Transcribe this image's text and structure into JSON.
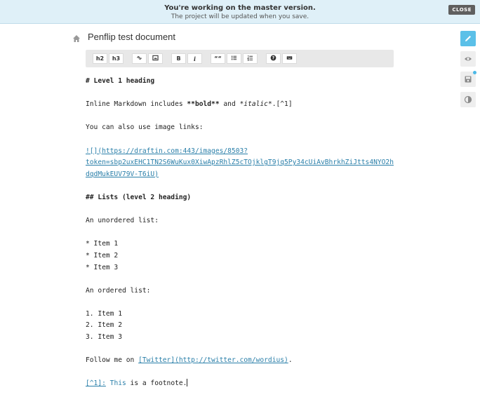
{
  "banner": {
    "title": "You're working on the master version.",
    "subtitle": "The project will be updated when you save.",
    "close_label": "CLOSE"
  },
  "document": {
    "title": "Penflip test document"
  },
  "toolbar": {
    "h2": "h2",
    "h3": "h3",
    "bold": "B",
    "italic": "i",
    "quote": "““",
    "help": "?"
  },
  "editor": {
    "l1": "# Level 1 heading",
    "l2_prefix": "Inline Markdown includes ",
    "l2_bold": "**bold**",
    "l2_mid": " and ",
    "l2_italic": "*italic*",
    "l2_suffix": ".[^1]",
    "l3": "You can also use image links:",
    "l4_bracket": "![]",
    "l4_url": "(https://draftin.com:443/images/8503?",
    "l5": "token=sbp2uxEHC1TN2S6WuKux0XiwApzRhlZ5cTOjklgT9jq5Py34cUiAvBhrkhZiJtts4NYO2h",
    "l6": "dqdMukEUV79V-T6iU)",
    "l7": "## Lists (level 2 heading)",
    "l8": "An unordered list:",
    "l9": "* Item 1",
    "l10": "* Item 2",
    "l11": "* Item 3",
    "l12": "An ordered list:",
    "l13": "1. Item 1",
    "l14": "2. Item 2",
    "l15": "3. Item 3",
    "l16_prefix": "Follow me on ",
    "l16_link": "[Twitter]",
    "l16_url": "(http://twitter.com/wordius)",
    "l16_suffix": ".",
    "l17_ref": "[^1]:",
    "l17_this": " This",
    "l17_rest": " is a footnote."
  },
  "rail": {
    "icons": [
      "pencil-icon",
      "eye-icon",
      "save-icon",
      "contrast-icon"
    ],
    "accent": "#5bc0e8"
  }
}
